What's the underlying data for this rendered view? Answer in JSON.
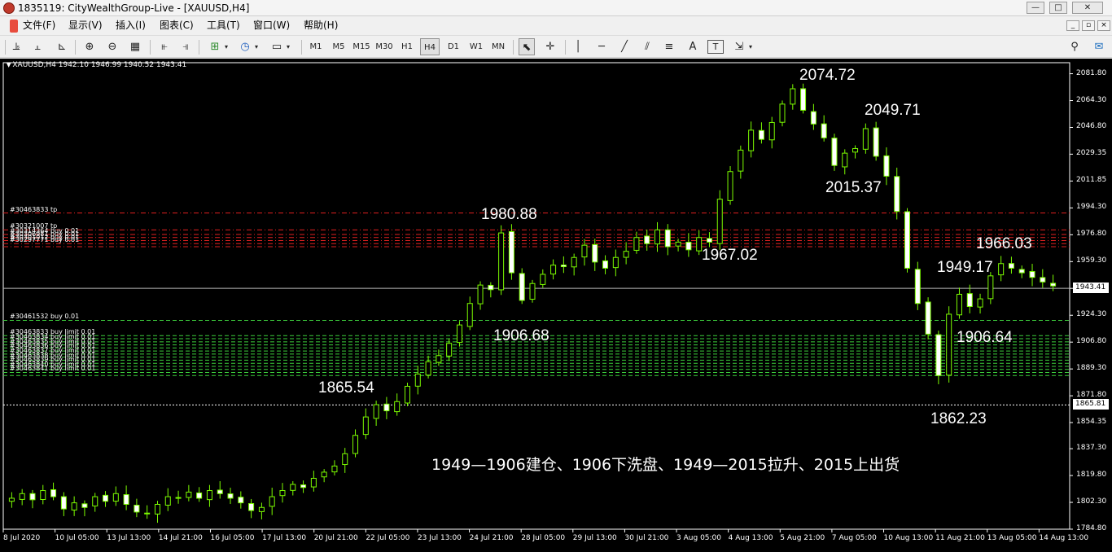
{
  "window": {
    "title": "1835119: CityWealthGroup-Live - [XAUUSD,H4]",
    "controls": [
      "—",
      "□",
      "✕"
    ]
  },
  "menu": {
    "items": [
      "文件(F)",
      "显示(V)",
      "插入(I)",
      "图表(C)",
      "工具(T)",
      "窗口(W)",
      "帮助(H)"
    ],
    "mdi_controls": [
      "_",
      "▫",
      "×"
    ]
  },
  "toolbar": {
    "timeframes": [
      "M1",
      "M5",
      "M15",
      "M30",
      "H1",
      "H4",
      "D1",
      "W1",
      "MN"
    ],
    "active_timeframe": "H4",
    "text_tool": "A",
    "label_tool": "T",
    "icons": [
      "new-chart-icon",
      "profiles-icon",
      "bar-chart-icon",
      "zoom-in-icon",
      "zoom-out-icon",
      "tile-windows-icon",
      "autoscroll-icon",
      "chart-shift-icon",
      "indicators-icon",
      "periods-icon",
      "templates-icon",
      "cursor-icon",
      "crosshair-icon",
      "vertical-line-icon",
      "horizontal-line-icon",
      "trendline-icon",
      "equidistant-channel-icon",
      "fibonacci-icon",
      "text-icon",
      "text-label-icon",
      "arrows-icon",
      "search-icon",
      "community-icon"
    ]
  },
  "chart": {
    "symbol_info": "XAUUSD,H4  1942.10 1946.99 1940.52 1943.41",
    "current_price": "1943.41",
    "line_price": "1865.81",
    "background": "#000000",
    "up_color": "#7cfc00",
    "grid": false
  },
  "order_labels": [
    {
      "text": "#30463833 tp",
      "price": 1991
    },
    {
      "text": "#30321007 tp",
      "price": 1980
    },
    {
      "text": "#30314364 buy 0.01",
      "price": 1977
    },
    {
      "text": "#30306981 buy 0.01",
      "price": 1975
    },
    {
      "text": "#30301012 buy 0.01",
      "price": 1973
    },
    {
      "text": "#30297771 buy 0.01",
      "price": 1971
    },
    {
      "text": "#30461532 buy 0.01",
      "price": 1921
    },
    {
      "text": "#30463833 buy limit 0.01",
      "price": 1911
    },
    {
      "text": "#30463834 buy limit 0.01",
      "price": 1908
    },
    {
      "text": "#30463835 buy limit 0.01",
      "price": 1905
    },
    {
      "text": "#30463836 buy limit 0.01",
      "price": 1902
    },
    {
      "text": "#30463837 buy limit 0.01",
      "price": 1899
    },
    {
      "text": "#30463838 buy limit 0.01",
      "price": 1896
    },
    {
      "text": "#30463839 buy limit 0.01",
      "price": 1893
    },
    {
      "text": "#30463840 buy limit 0.01",
      "price": 1890
    },
    {
      "text": "#30463841 buy limit 0.01",
      "price": 1887
    }
  ],
  "annotations": [
    {
      "text": "2074.72",
      "price": 2074.72
    },
    {
      "text": "2049.71",
      "price": 2049.71
    },
    {
      "text": "2015.37",
      "price": 2015.37
    },
    {
      "text": "1980.88",
      "price": 1980.88
    },
    {
      "text": "1967.02",
      "price": 1967.02
    },
    {
      "text": "1966.03",
      "price": 1966.03
    },
    {
      "text": "1949.17",
      "price": 1949.17
    },
    {
      "text": "1906.68",
      "price": 1906.68
    },
    {
      "text": "1906.64",
      "price": 1906.64
    },
    {
      "text": "1865.54",
      "price": 1865.54
    },
    {
      "text": "1862.23",
      "price": 1862.23
    }
  ],
  "note": "1949—1906建仓、1906下洗盘、1949—2015拉升、2015上出货",
  "chart_data": {
    "type": "candlestick",
    "symbol": "XAUUSD",
    "timeframe": "H4",
    "ylim": [
      1784.8,
      2089.0
    ],
    "y_ticks": [
      "2081.80",
      "2064.30",
      "2046.80",
      "2029.35",
      "2011.85",
      "1994.30",
      "1976.80",
      "1959.30",
      "1941.85",
      "1924.30",
      "1906.80",
      "1889.30",
      "1871.80",
      "1854.35",
      "1837.30",
      "1819.80",
      "1802.30",
      "1784.80"
    ],
    "x_ticks": [
      "8 Jul 2020",
      "10 Jul 05:00",
      "13 Jul 13:00",
      "14 Jul 21:00",
      "16 Jul 05:00",
      "17 Jul 13:00",
      "20 Jul 21:00",
      "22 Jul 05:00",
      "23 Jul 13:00",
      "24 Jul 21:00",
      "28 Jul 05:00",
      "29 Jul 13:00",
      "30 Jul 21:00",
      "3 Aug 05:00",
      "4 Aug 13:00",
      "5 Aug 21:00",
      "7 Aug 05:00",
      "10 Aug 13:00",
      "11 Aug 21:00",
      "13 Aug 05:00",
      "14 Aug 13:00"
    ],
    "price_line": 1941.85,
    "dashed_line": 1865.81,
    "close_path": [
      1805,
      1808,
      1804,
      1810,
      1806,
      1798,
      1802,
      1799,
      1806,
      1803,
      1808,
      1801,
      1796,
      1795,
      1801,
      1806,
      1805,
      1809,
      1805,
      1810,
      1808,
      1805,
      1802,
      1797,
      1799,
      1806,
      1810,
      1814,
      1812,
      1818,
      1822,
      1826,
      1834,
      1846,
      1858,
      1866,
      1862,
      1868,
      1878,
      1886,
      1894,
      1898,
      1906,
      1918,
      1932,
      1944,
      1941,
      1978,
      1952,
      1934,
      1945,
      1951,
      1957,
      1956,
      1962,
      1970,
      1959,
      1955,
      1962,
      1966,
      1975,
      1971,
      1980,
      1969,
      1972,
      1967,
      1975,
      1972,
      2000,
      2018,
      2032,
      2045,
      2039,
      2050,
      2062,
      2072,
      2058,
      2049,
      2040,
      2022,
      2030,
      2033,
      2046,
      2028,
      2015,
      1992,
      1955,
      1932,
      1912,
      1885,
      1925,
      1938,
      1930,
      1935,
      1950,
      1958,
      1955,
      1952,
      1949,
      1946,
      1943.41
    ]
  }
}
